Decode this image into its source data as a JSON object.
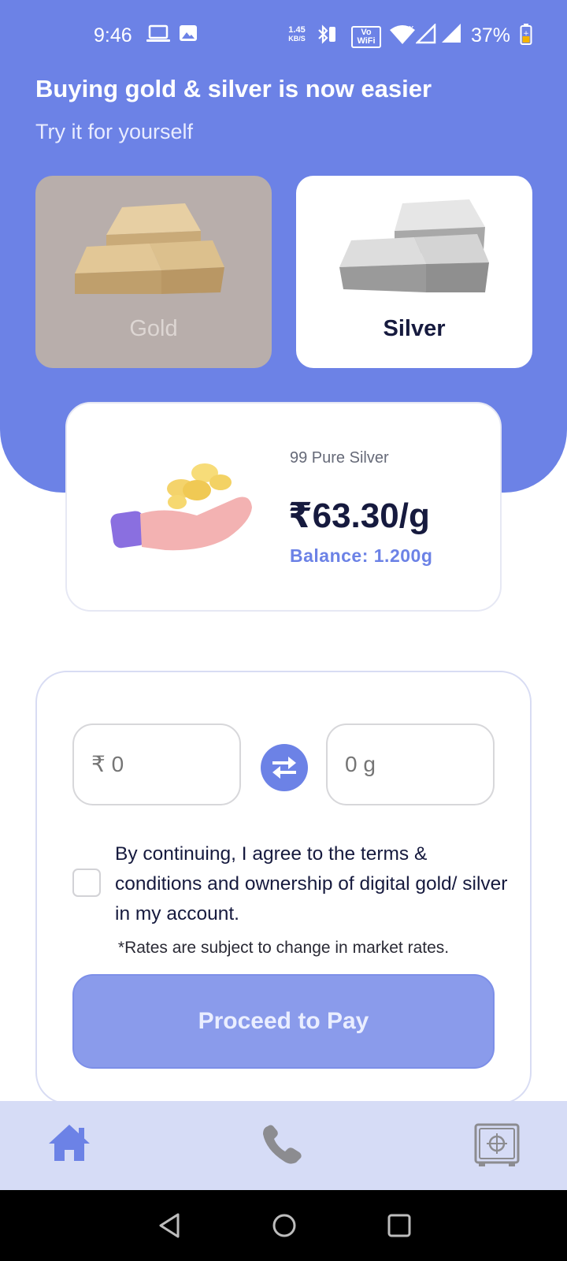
{
  "status_bar": {
    "time": "9:46",
    "net_speed_value": "1.45",
    "net_speed_unit": "KB/S",
    "volte_top": "Vo",
    "volte_bottom": "WiFi",
    "battery": "37%"
  },
  "header": {
    "title": "Buying gold & silver is now easier",
    "subtitle": "Try it for yourself"
  },
  "metals": [
    {
      "label": "Gold",
      "selected": false
    },
    {
      "label": "Silver",
      "selected": true
    }
  ],
  "price_card": {
    "purity": "99 Pure Silver",
    "price": "₹63.30/g",
    "balance": "Balance: 1.200g"
  },
  "form": {
    "rupee_placeholder": "₹ 0",
    "gram_placeholder": "0 g",
    "terms": "By continuing, I agree to the terms & conditions and ownership of digital gold/ silver in my account.",
    "terms_checked": false,
    "rates_note": "*Rates are subject to change in market rates.",
    "proceed_label": "Proceed to Pay"
  },
  "bottom_nav": {
    "items": [
      "home-icon",
      "phone-icon",
      "vault-icon"
    ],
    "active": "home-icon"
  },
  "colors": {
    "accent": "#6c82e6",
    "dark_text": "#161a3e",
    "gold_card": "#b8aeab",
    "nav_bg": "#d6dcf6"
  }
}
